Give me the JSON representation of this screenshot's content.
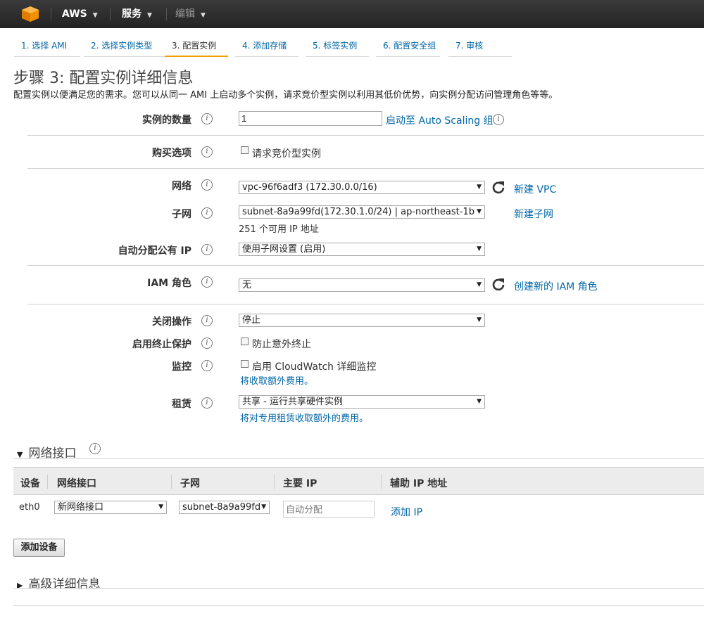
{
  "topbar": {
    "brand": "AWS",
    "services": "服务",
    "edit": "编辑"
  },
  "steps": [
    "1. 选择 AMI",
    "2. 选择实例类型",
    "3. 配置实例",
    "4. 添加存储",
    "5. 标签实例",
    "6. 配置安全组",
    "7. 审核"
  ],
  "page": {
    "title": "步骤 3: 配置实例详细信息",
    "desc": "配置实例以便满足您的需求。您可以从同一 AMI 上启动多个实例，请求竞价型实例以利用其低价优势，向实例分配访问管理角色等等。"
  },
  "form": {
    "count_label": "实例的数量",
    "count_value": "1",
    "autoscaling_link": "启动至 Auto Scaling 组",
    "purchase_label": "购买选项",
    "spot_checkbox": "请求竞价型实例",
    "network_label": "网络",
    "network_value": "vpc-96f6adf3 (172.30.0.0/16)",
    "new_vpc": "新建 VPC",
    "subnet_label": "子网",
    "subnet_value": "subnet-8a9a99fd(172.30.1.0/24) | ap-northeast-1b",
    "new_subnet": "新建子网",
    "subnet_ips": "251 个可用 IP 地址",
    "public_ip_label": "自动分配公有 IP",
    "public_ip_value": "使用子网设置 (启用)",
    "iam_label": "IAM 角色",
    "iam_value": "无",
    "new_iam": "创建新的 IAM 角色",
    "shutdown_label": "关闭操作",
    "shutdown_value": "停止",
    "termination_label": "启用终止保护",
    "termination_checkbox": "防止意外终止",
    "monitoring_label": "监控",
    "monitoring_checkbox": "启用 CloudWatch 详细监控",
    "monitoring_note": "将收取额外费用。",
    "tenancy_label": "租赁",
    "tenancy_value": "共享 - 运行共享硬件实例",
    "tenancy_note": "将对专用租赁收取额外的费用。"
  },
  "network_interfaces": {
    "title": "网络接口",
    "columns": [
      "设备",
      "网络接口",
      "子网",
      "主要 IP",
      "辅助 IP 地址"
    ],
    "rows": [
      {
        "device": "eth0",
        "interface": "新网络接口",
        "subnet": "subnet-8a9a99fd",
        "ip_placeholder": "自动分配",
        "add_ip": "添加 IP"
      }
    ],
    "add_device": "添加设备"
  },
  "advanced": {
    "title": "高级详细信息"
  }
}
